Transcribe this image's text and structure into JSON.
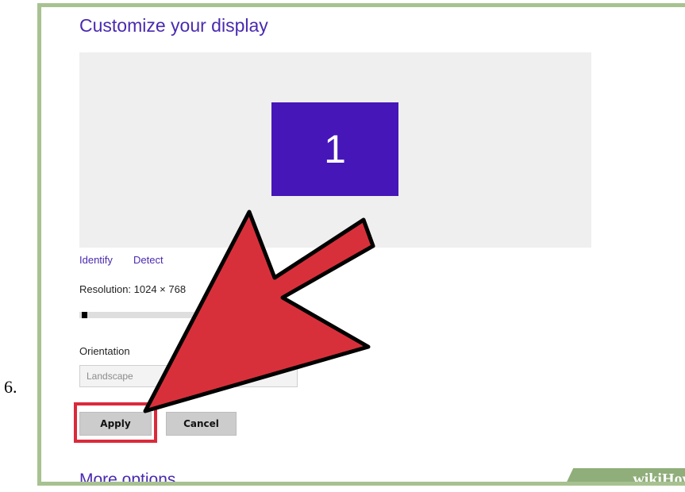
{
  "step": {
    "number": "6."
  },
  "display": {
    "title": "Customize your display",
    "monitor_label": "1",
    "identify_label": "Identify",
    "detect_label": "Detect",
    "resolution_label": "Resolution: 1024 × 768",
    "resolution_slider_level": 0.02,
    "orientation_label": "Orientation",
    "orientation_value": "Landscape",
    "apply_label": "Apply",
    "cancel_label": "Cancel",
    "more_options_label": "More options"
  },
  "watermark": {
    "wiki": "wiki",
    "how": "How"
  },
  "colors": {
    "accent_text": "#4a2ab0",
    "monitor_fill": "#4616b8",
    "arrow_fill": "#d8303b",
    "highlight": "#da2a3a",
    "frame_border": "#a7c290"
  },
  "icons": {
    "pointer": "red-arrow-icon"
  }
}
